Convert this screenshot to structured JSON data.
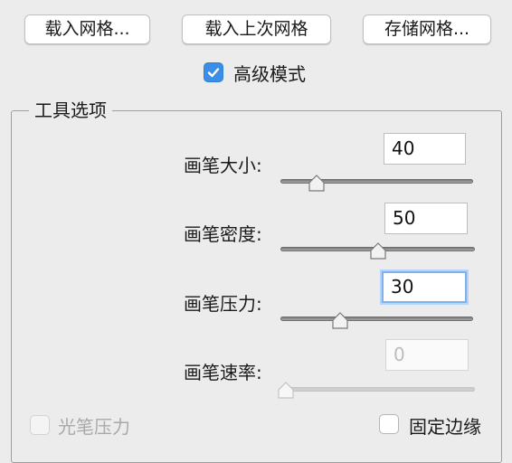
{
  "top_buttons": {
    "load_mesh": "载入网格...",
    "load_last_mesh": "载入上次网格",
    "save_mesh": "存储网格..."
  },
  "advanced_mode": {
    "label": "高级模式",
    "checked": true
  },
  "tool_options": {
    "title": "工具选项",
    "brush_size": {
      "label": "画笔大小:",
      "value": "40",
      "slider_fraction": 0.17
    },
    "brush_density": {
      "label": "画笔密度:",
      "value": "50",
      "slider_fraction": 0.5
    },
    "brush_pressure": {
      "label": "画笔压力:",
      "value": "30",
      "slider_fraction": 0.3,
      "focused": true
    },
    "brush_rate": {
      "label": "画笔速率:",
      "value": "0",
      "slider_fraction": 0.0,
      "disabled": true
    },
    "stylus_pressure": {
      "label": "光笔压力",
      "checked": false,
      "disabled": true
    },
    "pin_edges": {
      "label": "固定边缘",
      "checked": false
    }
  },
  "colors": {
    "accent": "#3a8ee6",
    "focus_ring": "#7eb1ef"
  }
}
